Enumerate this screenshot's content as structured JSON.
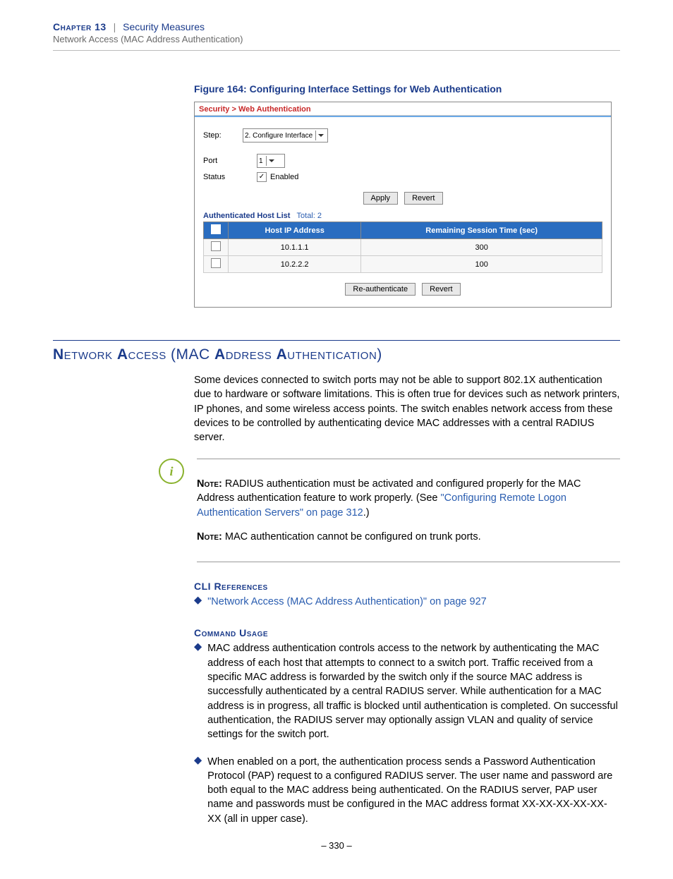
{
  "header": {
    "chapter": "Chapter 13",
    "title": "Security Measures",
    "subtitle": "Network Access (MAC Address Authentication)"
  },
  "figure": {
    "caption": "Figure 164:  Configuring Interface Settings for Web Authentication",
    "breadcrumb": "Security > Web Authentication",
    "step_label": "Step:",
    "step_value": "2. Configure Interface",
    "port_label": "Port",
    "port_value": "1",
    "status_label": "Status",
    "status_value": "Enabled",
    "btn_apply": "Apply",
    "btn_revert": "Revert",
    "list_label": "Authenticated Host List",
    "list_total_label": "Total:",
    "list_total": "2",
    "col1": "Host IP Address",
    "col2": "Remaining Session Time (sec)",
    "rows": [
      {
        "ip": "10.1.1.1",
        "time": "300"
      },
      {
        "ip": "10.2.2.2",
        "time": "100"
      }
    ],
    "btn_reauth": "Re-authenticate",
    "btn_revert2": "Revert"
  },
  "section": {
    "heading": "Network Access (MAC Address Authentication)",
    "para1": "Some devices connected to switch ports may not be able to support 802.1X authentication due to hardware or software limitations. This is often true for devices such as network printers, IP phones, and some wireless access points. The switch enables network access from these devices to be controlled by authenticating device MAC addresses with a central RADIUS server."
  },
  "note": {
    "label": "Note:",
    "text1a": "RADIUS authentication must be activated and configured properly for the MAC Address authentication feature to work properly. (See ",
    "link1": "\"Configuring Remote Logon Authentication Servers\" on page 312",
    "text1b": ".)",
    "text2": "MAC authentication cannot be configured on trunk ports."
  },
  "cli": {
    "heading": "CLI References",
    "link": "\"Network Access (MAC Address Authentication)\" on page 927"
  },
  "usage": {
    "heading": "Command Usage",
    "bullet1": "MAC address authentication controls access to the network by authenticating the MAC address of each host that attempts to connect to a switch port. Traffic received from a specific MAC address is forwarded by the switch only if the source MAC address is successfully authenticated by a central RADIUS server. While authentication for a MAC address is in progress, all traffic is blocked until authentication is completed. On successful authentication, the RADIUS server may optionally assign VLAN and quality of service settings for the switch port.",
    "bullet2": "When enabled on a port, the authentication process sends a Password Authentication Protocol (PAP) request to a configured RADIUS server. The user name and password are both equal to the MAC address being authenticated. On the RADIUS server, PAP user name and passwords must be configured in the MAC address format XX-XX-XX-XX-XX-XX (all in upper case)."
  },
  "pagenum": "–  330  –"
}
